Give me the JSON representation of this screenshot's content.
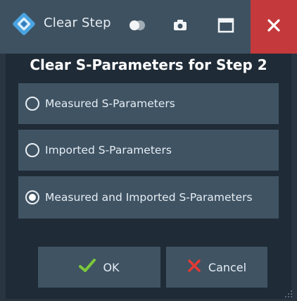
{
  "window": {
    "title": "Clear Step",
    "icons": [
      "app-logo-icon",
      "toggle-icon",
      "camera-icon",
      "maximize-icon",
      "close-icon"
    ]
  },
  "dialog": {
    "heading": "Clear S-Parameters for Step 2",
    "options": [
      {
        "label": "Measured S-Parameters",
        "selected": false
      },
      {
        "label": "Imported S-Parameters",
        "selected": false
      },
      {
        "label": "Measured and Imported S-Parameters",
        "selected": true
      }
    ],
    "buttons": {
      "ok_label": "OK",
      "cancel_label": "Cancel"
    }
  },
  "colors": {
    "titlebar": "#3e5160",
    "close": "#c43a3c",
    "panel": "#3f5363",
    "background": "#1f2b36",
    "ok_check": "#7cc83a",
    "cancel_x": "#e23a34"
  }
}
